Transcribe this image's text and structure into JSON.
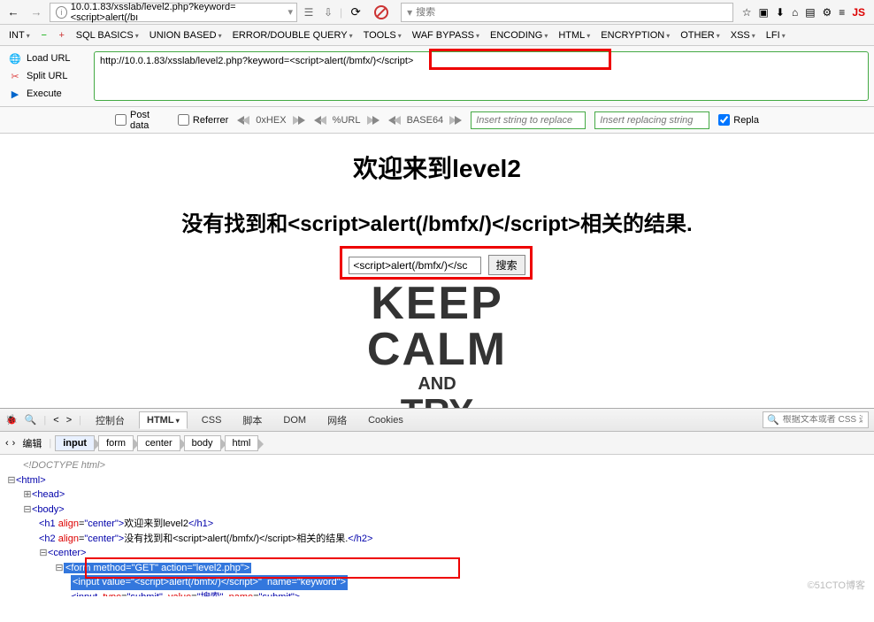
{
  "browser": {
    "url_display": "10.0.1.83/xsslab/level2.php?keyword=<script>alert(/bı",
    "search_placeholder": "搜索",
    "js_badge": "JS"
  },
  "hackbar": {
    "menu": [
      "SQL BASICS",
      "UNION BASED",
      "ERROR/DOUBLE QUERY",
      "TOOLS",
      "WAF BYPASS",
      "ENCODING",
      "HTML",
      "ENCRYPTION",
      "OTHER",
      "XSS",
      "LFI"
    ],
    "nt_label": "INT",
    "actions": {
      "load": "Load URL",
      "split": "Split URL",
      "execute": "Execute"
    },
    "url_value": "http://10.0.1.83/xsslab/level2.php?keyword=<script>alert(/bmfx/)</script>",
    "post_data": "Post data",
    "referrer": "Referrer",
    "enc_hex": "0xHEX",
    "enc_url": "%URL",
    "enc_b64": "BASE64",
    "insert1": "Insert string to replace",
    "insert2": "Insert replacing string",
    "repla": "Repla"
  },
  "page": {
    "h1": "欢迎来到level2",
    "h2_prefix": "没有找到和",
    "h2_script": "<script>alert(/bmfx/)</script>",
    "h2_suffix": "相关的结果.",
    "input_value": "<script>alert(/bmfx/)</sc",
    "search_btn": "搜索",
    "keep": {
      "l1": "KEEP",
      "l2": "CALM",
      "l3": "AND",
      "l4": "TRY"
    }
  },
  "devtools": {
    "tabs": [
      "控制台",
      "HTML",
      "CSS",
      "脚本",
      "DOM",
      "网络",
      "Cookies"
    ],
    "search_placeholder": "根据文本或者 CSS 选",
    "edit_label": "编辑",
    "breadcrumb": [
      "input",
      "form",
      "center",
      "body",
      "html"
    ],
    "source": {
      "doctype": "<!DOCTYPE html>",
      "html_open": "<html>",
      "head": "<head>",
      "body_open": "<body>",
      "h1_tag": "<h1 align=\"center\">",
      "h1_text": "欢迎来到level2",
      "h1_close": "</h1>",
      "h2_tag": "<h2 align=\"center\">",
      "h2_text": "没有找到和<script>alert(/bmfx/)</script>相关的结果.",
      "h2_close": "</h2>",
      "center_open": "<center>",
      "form_open": "<form method=\"GET\" action=\"level2.php\">",
      "input_sel": "<input value=\"<script>alert(/bmfx/)</script>\"  name=\"keyword\">",
      "input2": "<input  type=\"submit\"  value=\"搜索\"  name=\"submit\">"
    },
    "watermark": "©51CTO博客"
  }
}
